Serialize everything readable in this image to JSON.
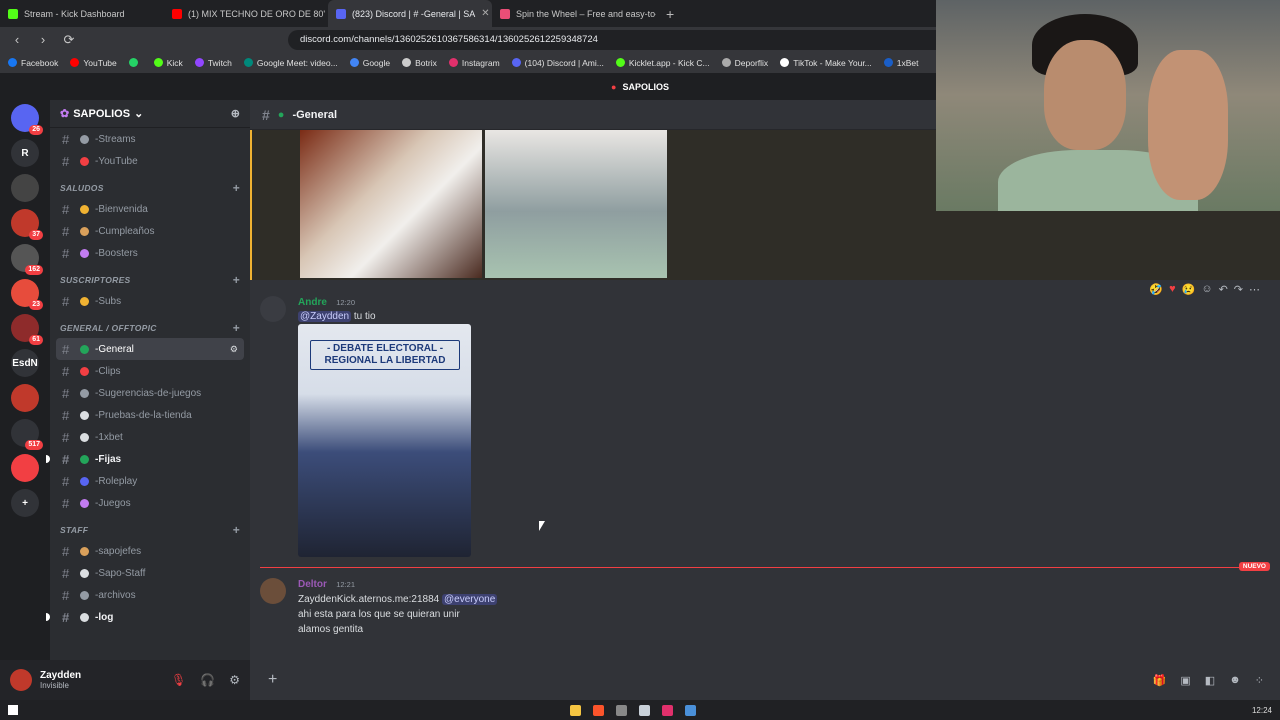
{
  "browser": {
    "tabs": [
      {
        "title": "Stream - Kick Dashboard",
        "color": "#53fc18"
      },
      {
        "title": "(1) MIX TECHNO DE ORO DE 80'",
        "color": "#ff0000"
      },
      {
        "title": "(823) Discord | # -General | SA",
        "color": "#5865f2",
        "active": true
      },
      {
        "title": "Spin the Wheel – Free and easy-to-u",
        "color": "#e94e77"
      }
    ],
    "url": "discord.com/channels/1360252610367586314/1360252612259348724",
    "bookmarks": [
      {
        "label": "Facebook",
        "color": "#1877f2"
      },
      {
        "label": "YouTube",
        "color": "#ff0000"
      },
      {
        "label": "",
        "color": "#25d366"
      },
      {
        "label": "Kick",
        "color": "#53fc18"
      },
      {
        "label": "Twitch",
        "color": "#9146ff"
      },
      {
        "label": "Google Meet: video...",
        "color": "#00897b"
      },
      {
        "label": "Google",
        "color": "#4285f4"
      },
      {
        "label": "Botrix",
        "color": "#cccccc"
      },
      {
        "label": "Instagram",
        "color": "#e1306c"
      },
      {
        "label": "(104) Discord | Ami...",
        "color": "#5865f2"
      },
      {
        "label": "Kicklet.app - Kick C...",
        "color": "#53fc18"
      },
      {
        "label": "Deporflix",
        "color": "#aaaaaa"
      },
      {
        "label": "TikTok - Make Your...",
        "color": "#ffffff"
      },
      {
        "label": "1xBet",
        "color": "#1a5ec7"
      }
    ]
  },
  "discord": {
    "notice": "SAPOLIOS",
    "server_name": "SAPOLIOS",
    "servers": [
      {
        "label": "",
        "badge": "26"
      },
      {
        "label": "R",
        "badge": ""
      },
      {
        "label": "",
        "badge": ""
      },
      {
        "label": "",
        "badge": "37"
      },
      {
        "label": "",
        "badge": "162"
      },
      {
        "label": "",
        "badge": "23"
      },
      {
        "label": "",
        "badge": "61"
      },
      {
        "label": "EsdN",
        "badge": ""
      },
      {
        "label": "",
        "badge": ""
      },
      {
        "label": "",
        "badge": "517"
      },
      {
        "label": "",
        "badge": ""
      }
    ],
    "top_channels": [
      {
        "name": "-Streams",
        "color": "#949ba4"
      },
      {
        "name": "-YouTube",
        "color": "#f23f43"
      }
    ],
    "categories": [
      {
        "name": "SALUDOS",
        "channels": [
          {
            "name": "-Bienvenida",
            "color": "#f0b232"
          },
          {
            "name": "-Cumpleaños",
            "color": "#d9a05b"
          },
          {
            "name": "-Boosters",
            "color": "#c27cf0"
          }
        ]
      },
      {
        "name": "SUSCRIPTORES",
        "channels": [
          {
            "name": "-Subs",
            "color": "#f0b232"
          }
        ]
      },
      {
        "name": "GENERAL / OFFTOPIC",
        "channels": [
          {
            "name": "-General",
            "color": "#23a55a",
            "active": true
          },
          {
            "name": "-Clips",
            "color": "#f23f43"
          },
          {
            "name": "-Sugerencias-de-juegos",
            "color": "#949ba4"
          },
          {
            "name": "-Pruebas-de-la-tienda",
            "color": "#dbdee1"
          },
          {
            "name": "-1xbet",
            "color": "#dbdee1"
          },
          {
            "name": "-Fijas",
            "color": "#23a55a",
            "bold": true
          },
          {
            "name": "-Roleplay",
            "color": "#5865f2"
          },
          {
            "name": "-Juegos",
            "color": "#c27cf0"
          }
        ]
      },
      {
        "name": "STAFF",
        "channels": [
          {
            "name": "-sapojefes",
            "color": "#d9a05b"
          },
          {
            "name": "-Sapo-Staff",
            "color": "#dbdee1"
          },
          {
            "name": "-archivos",
            "color": "#949ba4"
          },
          {
            "name": "-log",
            "color": "#dbdee1",
            "bold": true
          }
        ]
      }
    ],
    "channel_header": "-General",
    "messages": [
      {
        "author": "Andre",
        "author_color": "#23a55a",
        "time": "12:20",
        "mention": "@Zaydden",
        "text": "tu tio",
        "poster_title": "- DEBATE ELECTORAL - REGIONAL LA LIBERTAD"
      },
      {
        "author": "Deltor",
        "author_color": "#9b59b6",
        "time": "12:21",
        "line1": "ZayddenKick.aternos.me:21884",
        "mention": "@everyone",
        "line2": "ahi esta para los que se quieran unir",
        "line3": "alamos gentita"
      }
    ],
    "new_label": "NUEVO",
    "user": {
      "name": "Zaydden",
      "status": "Invisible"
    }
  },
  "taskbar": {
    "time": "12:24"
  }
}
